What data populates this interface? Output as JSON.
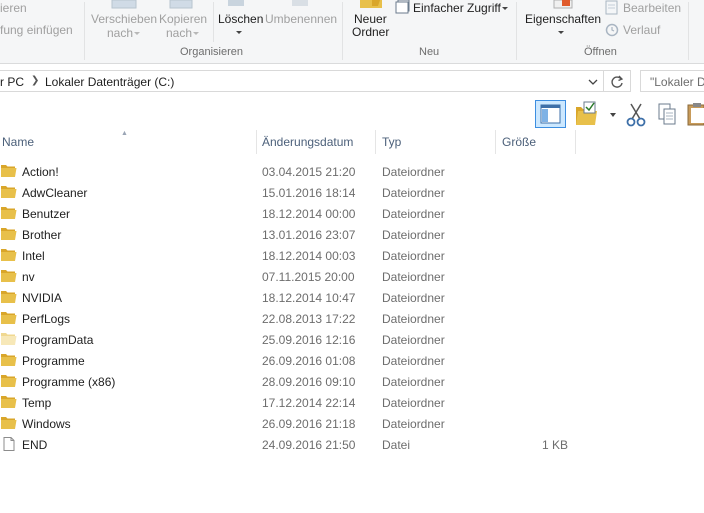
{
  "ribbon": {
    "clipboard": {
      "copy_path_fragment": "ieren",
      "paste_shortcut_fragment": "fung einfügen"
    },
    "organize": {
      "move_to_line1": "Verschieben",
      "move_to_line2": "nach",
      "copy_to_line1": "Kopieren",
      "copy_to_line2": "nach",
      "delete_label": "Löschen",
      "rename_label": "Umbenennen",
      "group_label": "Organisieren"
    },
    "new": {
      "new_folder_line1": "Neuer",
      "new_folder_line2": "Ordner",
      "easy_access_label": "Einfacher Zugriff",
      "group_label": "Neu"
    },
    "open": {
      "properties_label": "Eigenschaften",
      "edit_label": "Bearbeiten",
      "history_label": "Verlauf",
      "group_label": "Öffnen"
    }
  },
  "address_bar": {
    "crumb_pc_fragment": "r PC",
    "crumb_drive": "Lokaler Datenträger (C:)"
  },
  "search": {
    "placeholder_fragment": "\"Lokaler D"
  },
  "columns": {
    "name": "Name",
    "date": "Änderungsdatum",
    "type": "Typ",
    "size": "Größe"
  },
  "files": [
    {
      "name": "Action!",
      "date": "03.04.2015 21:20",
      "type": "Dateiordner",
      "size": "",
      "icon": "folder-icon"
    },
    {
      "name": "AdwCleaner",
      "date": "15.01.2016 18:14",
      "type": "Dateiordner",
      "size": "",
      "icon": "folder-icon"
    },
    {
      "name": "Benutzer",
      "date": "18.12.2014 00:00",
      "type": "Dateiordner",
      "size": "",
      "icon": "folder-icon"
    },
    {
      "name": "Brother",
      "date": "13.01.2016 23:07",
      "type": "Dateiordner",
      "size": "",
      "icon": "folder-icon"
    },
    {
      "name": "Intel",
      "date": "18.12.2014 00:03",
      "type": "Dateiordner",
      "size": "",
      "icon": "folder-icon"
    },
    {
      "name": "nv",
      "date": "07.11.2015 20:00",
      "type": "Dateiordner",
      "size": "",
      "icon": "folder-icon"
    },
    {
      "name": "NVIDIA",
      "date": "18.12.2014 10:47",
      "type": "Dateiordner",
      "size": "",
      "icon": "folder-icon"
    },
    {
      "name": "PerfLogs",
      "date": "22.08.2013 17:22",
      "type": "Dateiordner",
      "size": "",
      "icon": "folder-icon"
    },
    {
      "name": "ProgramData",
      "date": "25.09.2016 12:16",
      "type": "Dateiordner",
      "size": "",
      "icon": "hidden-folder-icon"
    },
    {
      "name": "Programme",
      "date": "26.09.2016 01:08",
      "type": "Dateiordner",
      "size": "",
      "icon": "folder-icon"
    },
    {
      "name": "Programme (x86)",
      "date": "28.09.2016 09:10",
      "type": "Dateiordner",
      "size": "",
      "icon": "folder-icon"
    },
    {
      "name": "Temp",
      "date": "17.12.2014 22:14",
      "type": "Dateiordner",
      "size": "",
      "icon": "folder-icon"
    },
    {
      "name": "Windows",
      "date": "26.09.2016 21:18",
      "type": "Dateiordner",
      "size": "",
      "icon": "folder-icon"
    },
    {
      "name": "END",
      "date": "24.09.2016 21:50",
      "type": "Datei",
      "size": "1 KB",
      "icon": "file-icon"
    }
  ],
  "colors": {
    "folder": "#e8c04a",
    "folder_dark": "#d9a62a",
    "header_text": "#4c607a",
    "selected_view": "#cce8ff",
    "accent": "#3d8ee0"
  }
}
